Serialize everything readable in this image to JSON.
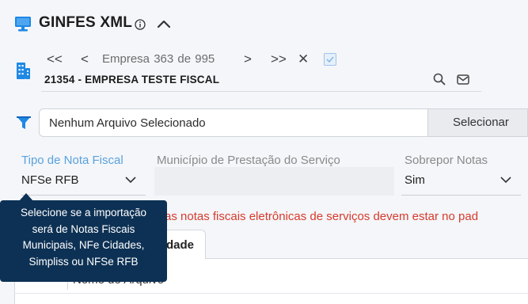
{
  "header": {
    "title": "GINFES XML"
  },
  "nav": {
    "first": "<<",
    "prev": "<",
    "record_text": "Empresa 363 de 995",
    "next": ">",
    "last": ">>",
    "close": "✕",
    "company": "21354 - EMPRESA TESTE FISCAL"
  },
  "file": {
    "value": "Nenhum Arquivo Selecionado",
    "select_label": "Selecionar"
  },
  "fields": {
    "tipo": {
      "label": "Tipo de Nota Fiscal",
      "value": "NFSe RFB"
    },
    "municipio": {
      "label": "Município de Prestação do Serviço",
      "value": ""
    },
    "sobrepor": {
      "label": "Sobrepor Notas",
      "value": "Sim"
    }
  },
  "error": {
    "text": "as notas fiscais eletrônicas de serviços devem estar no pad"
  },
  "tabs": [
    {
      "label": "dade"
    }
  ],
  "table": {
    "columns": [
      "Nome do Arquivo"
    ]
  },
  "tooltip": {
    "lines": [
      "Selecione se a importação",
      "será de Notas Fiscais",
      "Municipais, NFe Cidades,",
      "Simpliss ou NFSe RFB"
    ]
  },
  "colors": {
    "accent": "#1e88e5",
    "tooltip_bg": "#0d3154",
    "error": "#d83a2c",
    "active_label": "#5aa1dd"
  },
  "icons": [
    "computer-icon",
    "info-icon",
    "chevron-up-icon",
    "building-icon",
    "search-icon",
    "mail-icon",
    "filter-icon",
    "chevron-down-icon",
    "checkbox-icon"
  ]
}
